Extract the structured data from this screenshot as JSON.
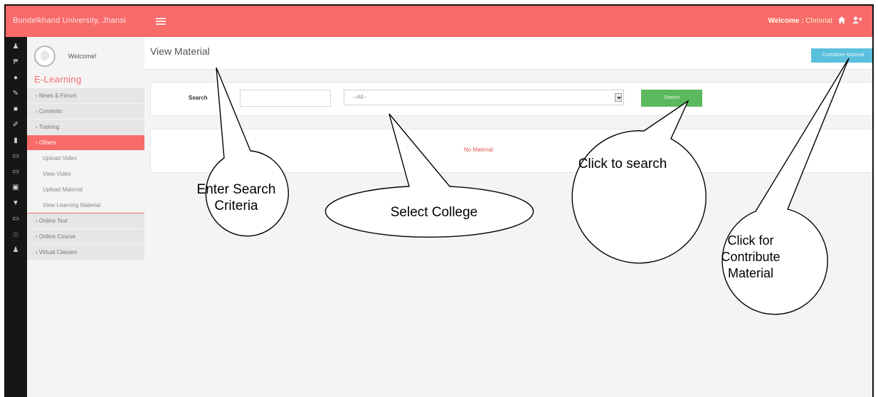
{
  "topbar": {
    "brand": "Bundelkhand University, Jhansi",
    "welcome_prefix": "Welcome :",
    "welcome_user": "Chmmat",
    "user_caret": "▾"
  },
  "sidebar": {
    "welcome_label": "Welcome!",
    "section_title": "E-Learning",
    "items": [
      {
        "label": "› News & Forum"
      },
      {
        "label": "› Contents"
      },
      {
        "label": "› Training"
      },
      {
        "label": "› Others"
      }
    ],
    "sub_items": [
      {
        "label": "Upload Video"
      },
      {
        "label": "View Video"
      },
      {
        "label": "Upload Material"
      },
      {
        "label": "View Learning Material"
      }
    ],
    "items_after": [
      {
        "label": "› Online Test"
      },
      {
        "label": "› Online Course"
      },
      {
        "label": "› Virtual Classes"
      }
    ]
  },
  "main": {
    "page_title": "View Material",
    "contribute_label": "Contribute Material",
    "search_label": "Search",
    "search_value": "",
    "college_selected": "--All--",
    "search_button": "Search",
    "no_material": "No Material"
  },
  "callouts": {
    "enter_search": "Enter Search Criteria",
    "select_college": "Select College",
    "click_search": "Click to search",
    "click_contribute": "Click for Contribute Material"
  },
  "colors": {
    "topbar": "#f76b6b",
    "accent": "#f76b6b",
    "search_button": "#5cb85c",
    "contribute_button": "#5bc0de"
  }
}
